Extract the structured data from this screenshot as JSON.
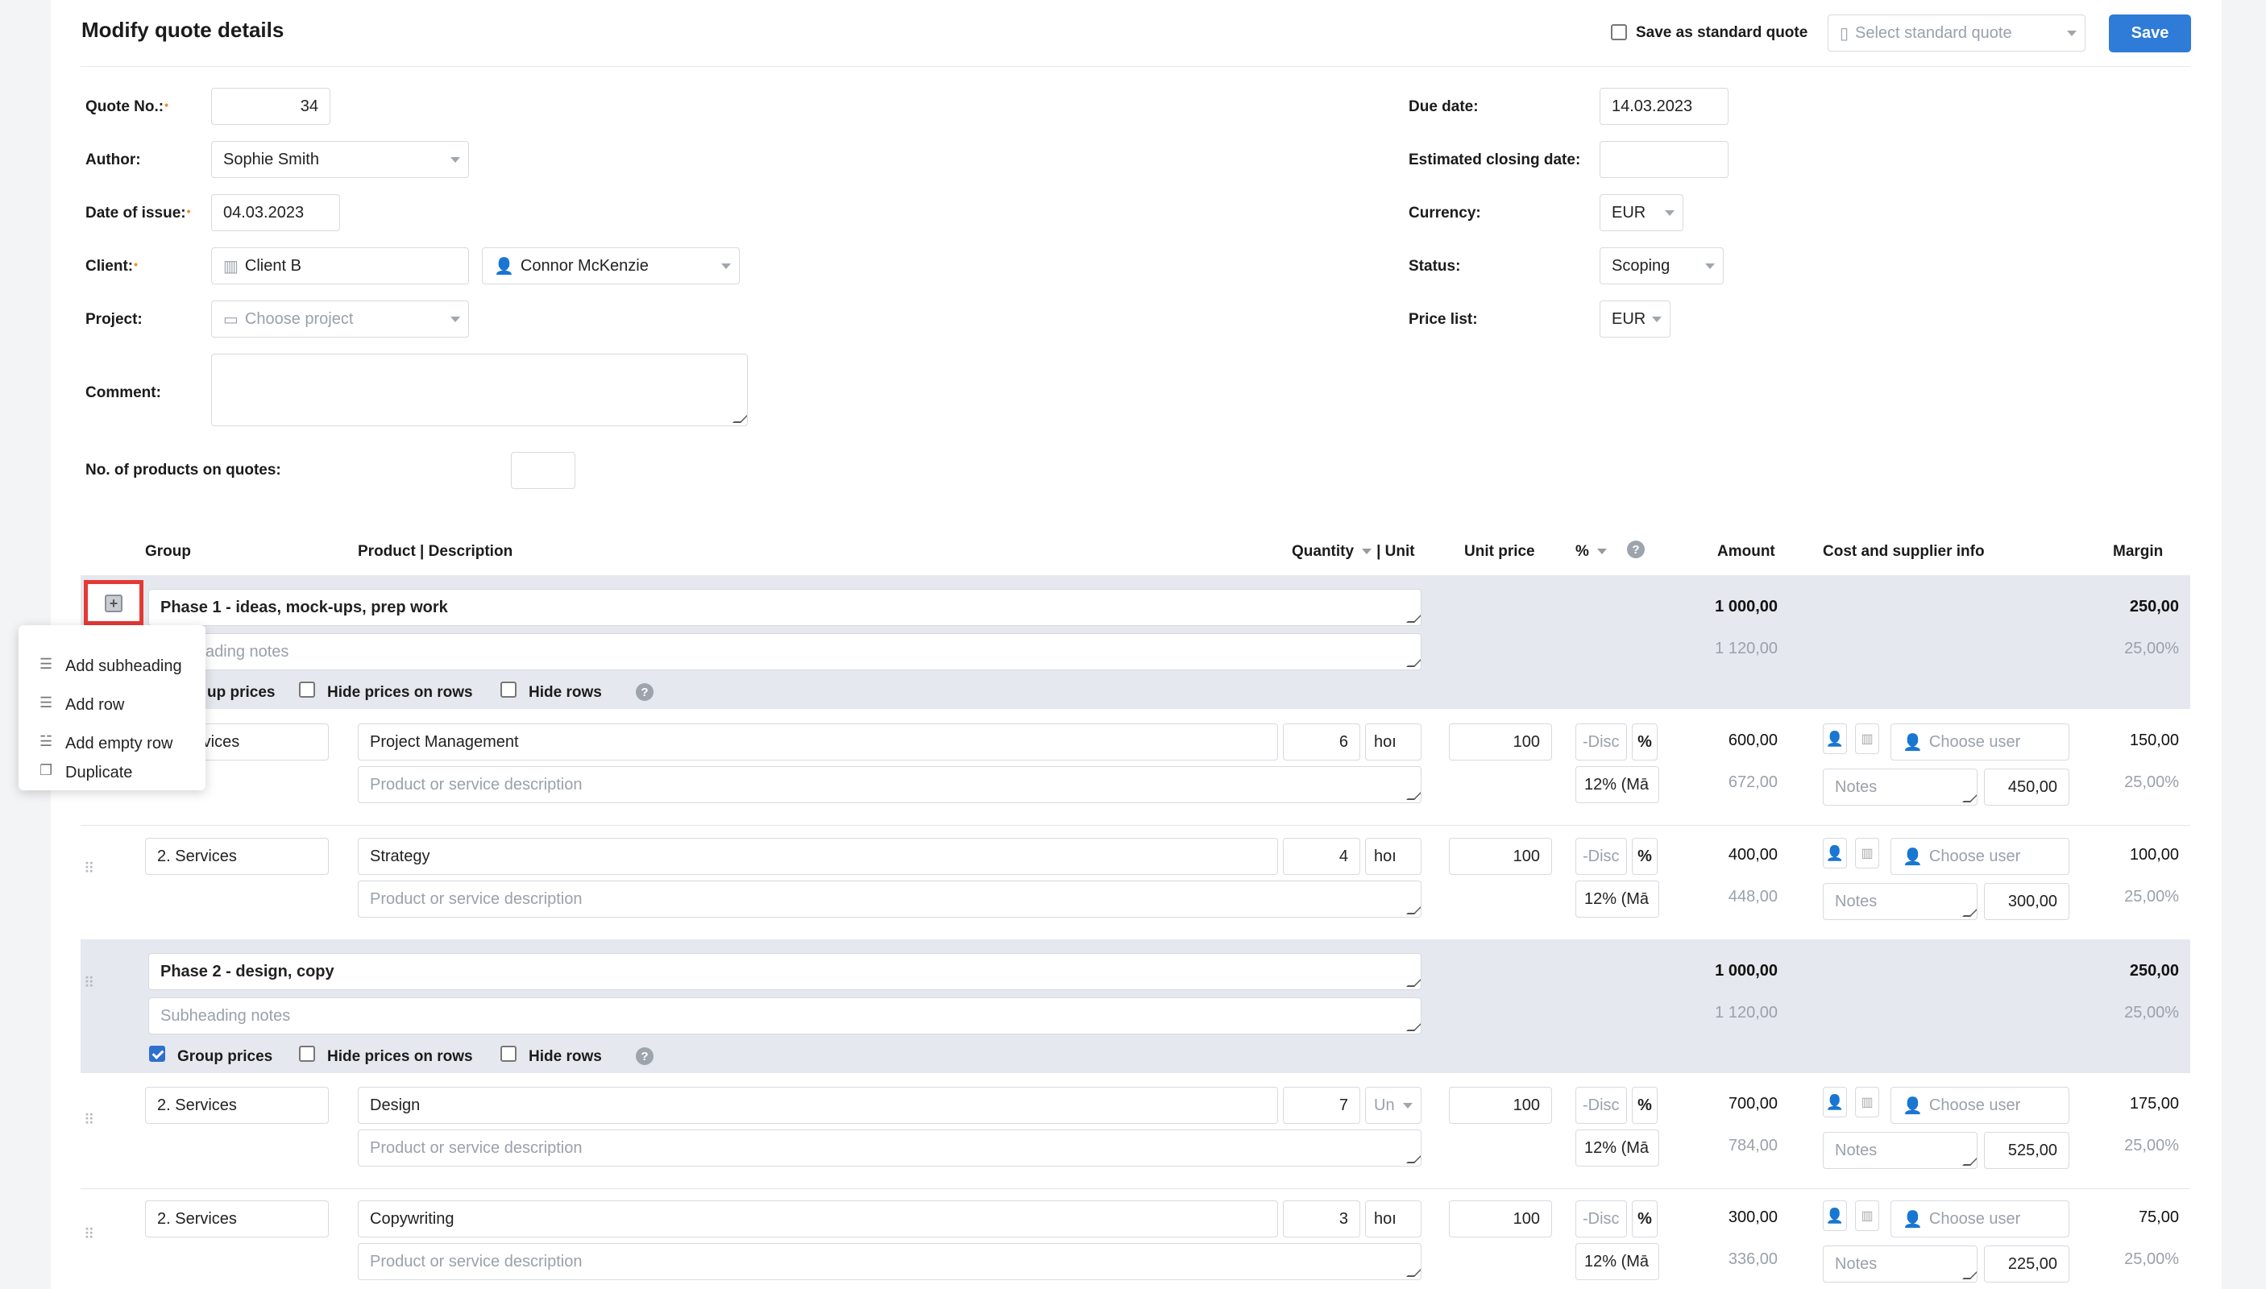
{
  "page": {
    "title": "Modify quote details"
  },
  "toolbar": {
    "save_standard_label": "Save as standard quote",
    "standard_quote_placeholder": "Select standard quote",
    "save_label": "Save"
  },
  "form": {
    "quote_no_label": "Quote No.:",
    "quote_no": "34",
    "author_label": "Author:",
    "author": "Sophie Smith",
    "date_issue_label": "Date of issue:",
    "date_issue": "04.03.2023",
    "client_label": "Client:",
    "client": "Client B",
    "contact": "Connor McKenzie",
    "project_label": "Project:",
    "project_placeholder": "Choose project",
    "comment_label": "Comment:",
    "products_label": "No. of products on quotes:",
    "due_label": "Due date:",
    "due": "14.03.2023",
    "closing_label": "Estimated closing date:",
    "currency_label": "Currency:",
    "currency": "EUR",
    "status_label": "Status:",
    "status": "Scoping",
    "pricelist_label": "Price list:",
    "pricelist": "EUR"
  },
  "table": {
    "h_group": "Group",
    "h_product": "Product | Description",
    "h_quantity": "Quantity",
    "h_unit": "| Unit",
    "h_unit_price": "Unit price",
    "h_percent": "%",
    "h_amount": "Amount",
    "h_cost": "Cost and supplier info",
    "h_margin": "Margin"
  },
  "common": {
    "desc_placeholder": "Product or service description",
    "disc_placeholder": "-Disc",
    "pct": "%",
    "vat": "12% (Mā",
    "choose_user": "Choose user",
    "notes_placeholder": "Notes",
    "group_prices": "Group prices",
    "hide_prices": "Hide prices on rows",
    "hide_rows": "Hide rows",
    "subheading_notes": "Subheading notes",
    "qm": "?"
  },
  "phases": [
    {
      "title": "Phase 1 - ideas, mock-ups, prep work",
      "notes_visible": "ading notes",
      "group_prices_visible": "up prices",
      "amount": "1 000,00",
      "amount_vat": "1 120,00",
      "margin": "250,00",
      "margin_pct": "25,00%"
    },
    {
      "title": "Phase 2 - design, copy",
      "amount": "1 000,00",
      "amount_vat": "1 120,00",
      "margin": "250,00",
      "margin_pct": "25,00%"
    }
  ],
  "rows": [
    {
      "group": "rvices",
      "product": "Project Management",
      "qty": "6",
      "unit": "hoı",
      "price": "100",
      "amount": "600,00",
      "amount_vat": "672,00",
      "cost": "450,00",
      "margin": "150,00",
      "margin_pct": "25,00%"
    },
    {
      "group": "2. Services",
      "product": "Strategy",
      "qty": "4",
      "unit": "hoı",
      "price": "100",
      "amount": "400,00",
      "amount_vat": "448,00",
      "cost": "300,00",
      "margin": "100,00",
      "margin_pct": "25,00%"
    },
    {
      "group": "2. Services",
      "product": "Design",
      "qty": "7",
      "unit": "Un",
      "price": "100",
      "amount": "700,00",
      "amount_vat": "784,00",
      "cost": "525,00",
      "margin": "175,00",
      "margin_pct": "25,00%"
    },
    {
      "group": "2. Services",
      "product": "Copywriting",
      "qty": "3",
      "unit": "hoı",
      "price": "100",
      "amount": "300,00",
      "amount_vat": "336,00",
      "cost": "225,00",
      "margin": "75,00",
      "margin_pct": "25,00%"
    }
  ],
  "context_menu": {
    "items": [
      "Add subheading",
      "Add row",
      "Add empty row",
      "Duplicate"
    ]
  },
  "colors": {
    "accent": "#2f7bd8",
    "band": "#e5e8ee",
    "highlight": "#e53935",
    "required": "#f28c28"
  }
}
